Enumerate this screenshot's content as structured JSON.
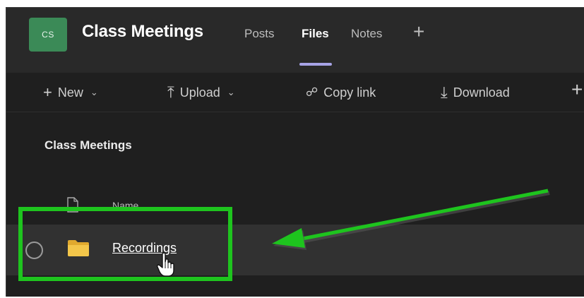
{
  "header": {
    "avatar_initials": "CS",
    "team_name": "Class Meetings",
    "tabs": [
      {
        "label": "Posts",
        "active": false
      },
      {
        "label": "Files",
        "active": true
      },
      {
        "label": "Notes",
        "active": false
      }
    ],
    "add_tab_label": "+"
  },
  "toolbar": {
    "new_label": "New",
    "upload_label": "Upload",
    "copy_link_label": "Copy link",
    "download_label": "Download",
    "more_label": "+"
  },
  "breadcrumb": "Class Meetings",
  "list": {
    "column_name_label": "Name",
    "rows": [
      {
        "name": "Recordings",
        "type": "folder"
      }
    ]
  },
  "icons": {
    "folder": "folder-icon",
    "file_type": "file-icon",
    "cursor": "hand-pointer-icon"
  },
  "colors": {
    "accent": "#a7a3e6",
    "avatar": "#3b8a57",
    "folder": "#f3c64a",
    "annotation": "#1ec41e",
    "background": "#1f1f1f"
  }
}
